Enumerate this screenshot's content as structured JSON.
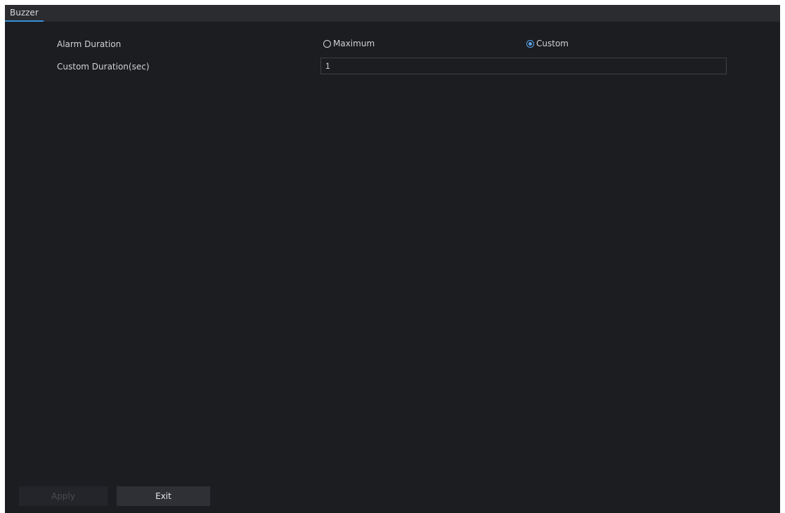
{
  "tabs": [
    {
      "label": "Buzzer"
    }
  ],
  "alarm_duration": {
    "label": "Alarm Duration",
    "options": [
      {
        "label": "Maximum",
        "checked": false
      },
      {
        "label": "Custom",
        "checked": true
      }
    ]
  },
  "custom_duration": {
    "label": "Custom Duration(sec)",
    "value": "1"
  },
  "buttons": {
    "apply": "Apply",
    "exit": "Exit"
  },
  "colors": {
    "background": "#1c1d20",
    "accent": "#3a8fd6"
  }
}
